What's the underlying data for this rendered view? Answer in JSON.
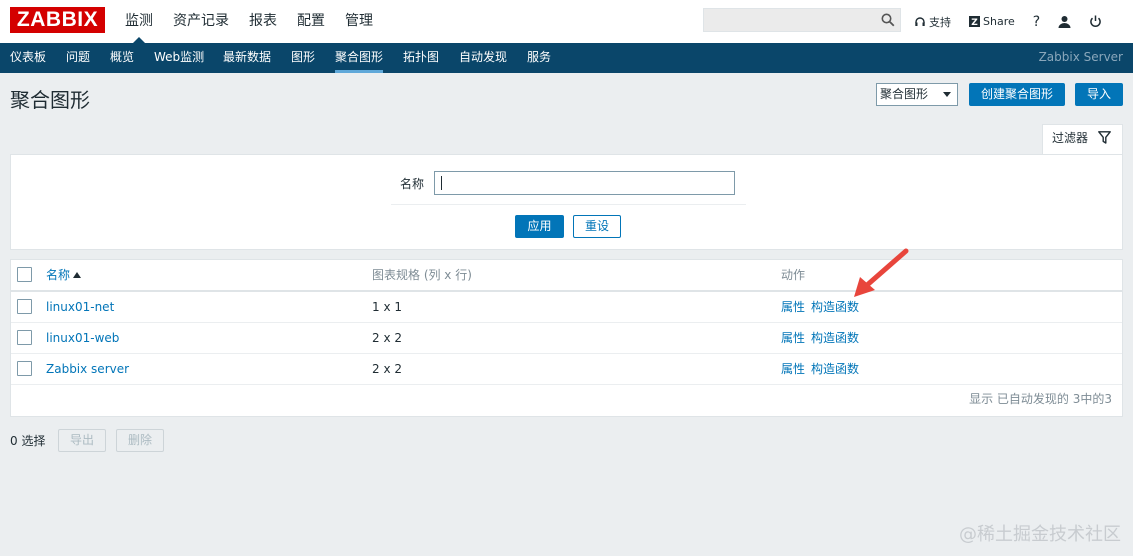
{
  "logo": {
    "text": "ZABBIX"
  },
  "main_menu": [
    {
      "label": "监测",
      "active": true
    },
    {
      "label": "资产记录"
    },
    {
      "label": "报表"
    },
    {
      "label": "配置"
    },
    {
      "label": "管理"
    }
  ],
  "top_links": {
    "support": "支持",
    "share": "Share",
    "help": "?"
  },
  "sub_nav": {
    "items": [
      "仪表板",
      "问题",
      "概览",
      "Web监测",
      "最新数据",
      "图形",
      "聚合图形",
      "拓扑图",
      "自动发现",
      "服务"
    ],
    "active": "聚合图形",
    "server_name": "Zabbix Server"
  },
  "header": {
    "title": "聚合图形",
    "select_value": "聚合图形",
    "create_button": "创建聚合图形",
    "import_button": "导入"
  },
  "filter": {
    "tab_label": "过滤器",
    "name_label": "名称",
    "name_value": "",
    "apply_button": "应用",
    "reset_button": "重设"
  },
  "table": {
    "columns": {
      "name": "名称",
      "dimension": "图表规格 (列 x 行)",
      "actions": "动作"
    },
    "rows": [
      {
        "name": "linux01-net",
        "dimension": "1 x 1",
        "action_props": "属性",
        "action_constructor": "构造函数"
      },
      {
        "name": "linux01-web",
        "dimension": "2 x 2",
        "action_props": "属性",
        "action_constructor": "构造函数"
      },
      {
        "name": "Zabbix server",
        "dimension": "2 x 2",
        "action_props": "属性",
        "action_constructor": "构造函数"
      }
    ],
    "footer": "显示 已自动发现的 3中的3"
  },
  "bottom": {
    "selected": "0 选择",
    "export_button": "导出",
    "delete_button": "删除"
  },
  "watermark": "@稀土掘金技术社区",
  "colors": {
    "brand_red": "#d40000",
    "nav_blue": "#0a466a",
    "accent": "#0275b8",
    "annotation": "#e8453c"
  }
}
